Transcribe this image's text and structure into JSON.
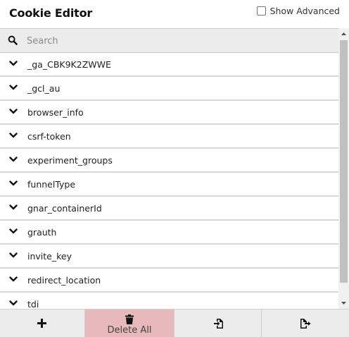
{
  "header": {
    "title": "Cookie Editor",
    "show_advanced_label": "Show Advanced",
    "show_advanced_checked": false
  },
  "search": {
    "placeholder": "Search",
    "icon": "search-icon"
  },
  "cookies": [
    {
      "name": "_ga_CBK9K2ZWWE"
    },
    {
      "name": "_gcl_au"
    },
    {
      "name": "browser_info"
    },
    {
      "name": "csrf-token"
    },
    {
      "name": "experiment_groups"
    },
    {
      "name": "funnelType"
    },
    {
      "name": "gnar_containerId"
    },
    {
      "name": "grauth"
    },
    {
      "name": "invite_key"
    },
    {
      "name": "redirect_location"
    },
    {
      "name": "tdi"
    }
  ],
  "footer": {
    "add_icon": "plus-icon",
    "delete_all_label": "Delete All",
    "delete_icon": "trash-icon",
    "import_icon": "file-import-icon",
    "export_icon": "file-export-icon",
    "delete_color": "#e8b9bb"
  }
}
